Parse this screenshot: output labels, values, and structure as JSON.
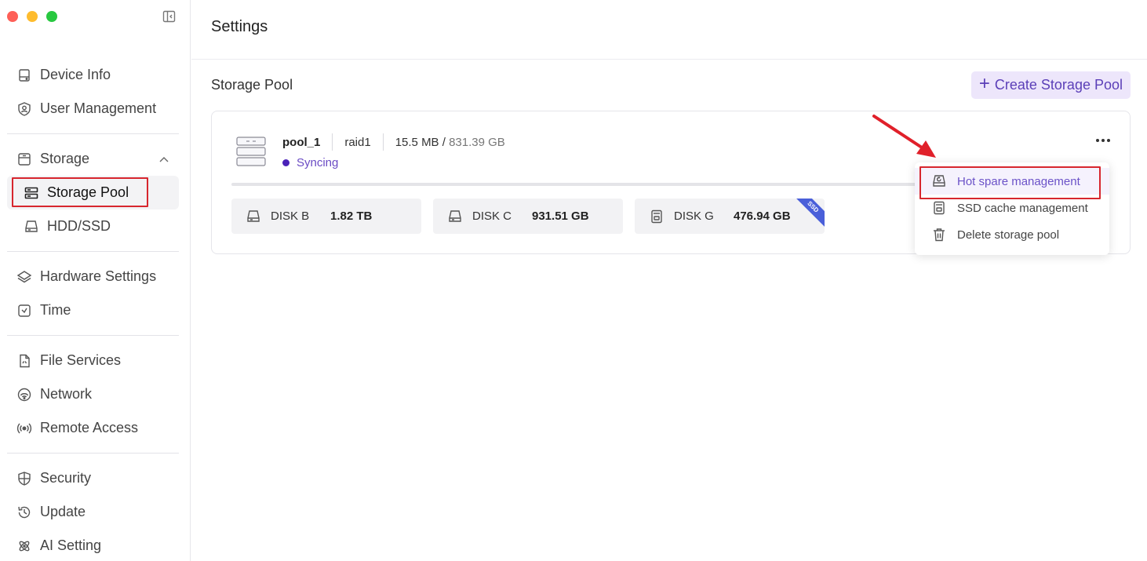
{
  "window": {
    "controls": [
      "close",
      "minimize",
      "zoom"
    ]
  },
  "sidebar": {
    "collapse_icon": "sidebar-collapse-icon",
    "groups": [
      {
        "items": [
          {
            "label": "Device Info",
            "icon": "device-icon"
          },
          {
            "label": "User Management",
            "icon": "user-icon"
          }
        ]
      },
      {
        "items": [
          {
            "label": "Storage",
            "icon": "storage-icon",
            "expanded": true
          },
          {
            "label": "Storage Pool",
            "icon": "storage-pool-icon",
            "active": true
          },
          {
            "label": "HDD/SSD",
            "icon": "hdd-icon"
          }
        ]
      },
      {
        "items": [
          {
            "label": "Hardware Settings",
            "icon": "layers-icon"
          },
          {
            "label": "Time",
            "icon": "clock-icon"
          }
        ]
      },
      {
        "items": [
          {
            "label": "File Services",
            "icon": "file-icon"
          },
          {
            "label": "Network",
            "icon": "network-icon"
          },
          {
            "label": "Remote Access",
            "icon": "broadcast-icon"
          }
        ]
      },
      {
        "items": [
          {
            "label": "Security",
            "icon": "shield-icon"
          },
          {
            "label": "Update",
            "icon": "history-icon"
          },
          {
            "label": "AI Setting",
            "icon": "ai-icon"
          }
        ]
      }
    ]
  },
  "header": {
    "title": "Settings"
  },
  "section": {
    "title": "Storage Pool",
    "create_label": "Create Storage Pool",
    "create_icon": "plus-icon"
  },
  "pool": {
    "name": "pool_1",
    "raid": "raid1",
    "used": "15.5 MB",
    "total_sep": "/",
    "total": "831.39 GB",
    "status": "Syncing",
    "status_color": "#4a22b8",
    "disks": [
      {
        "name": "DISK B",
        "size": "1.82 TB",
        "icon": "hdd-icon"
      },
      {
        "name": "DISK C",
        "size": "931.51 GB",
        "icon": "hdd-icon"
      },
      {
        "name": "DISK G",
        "size": "476.94 GB",
        "icon": "ssd-icon",
        "tag": "SSD"
      }
    ]
  },
  "menu": {
    "items": [
      {
        "label": "Hot spare management",
        "icon": "hot-spare-icon",
        "highlighted": true
      },
      {
        "label": "SSD cache management",
        "icon": "ssd-cache-icon"
      },
      {
        "label": "Delete storage pool",
        "icon": "trash-icon"
      }
    ]
  },
  "colors": {
    "accent": "#5b3fb8",
    "accent_bg": "#ede6fb",
    "annotation": "#d7262e",
    "ssd_tag": "#4a5fd9"
  }
}
